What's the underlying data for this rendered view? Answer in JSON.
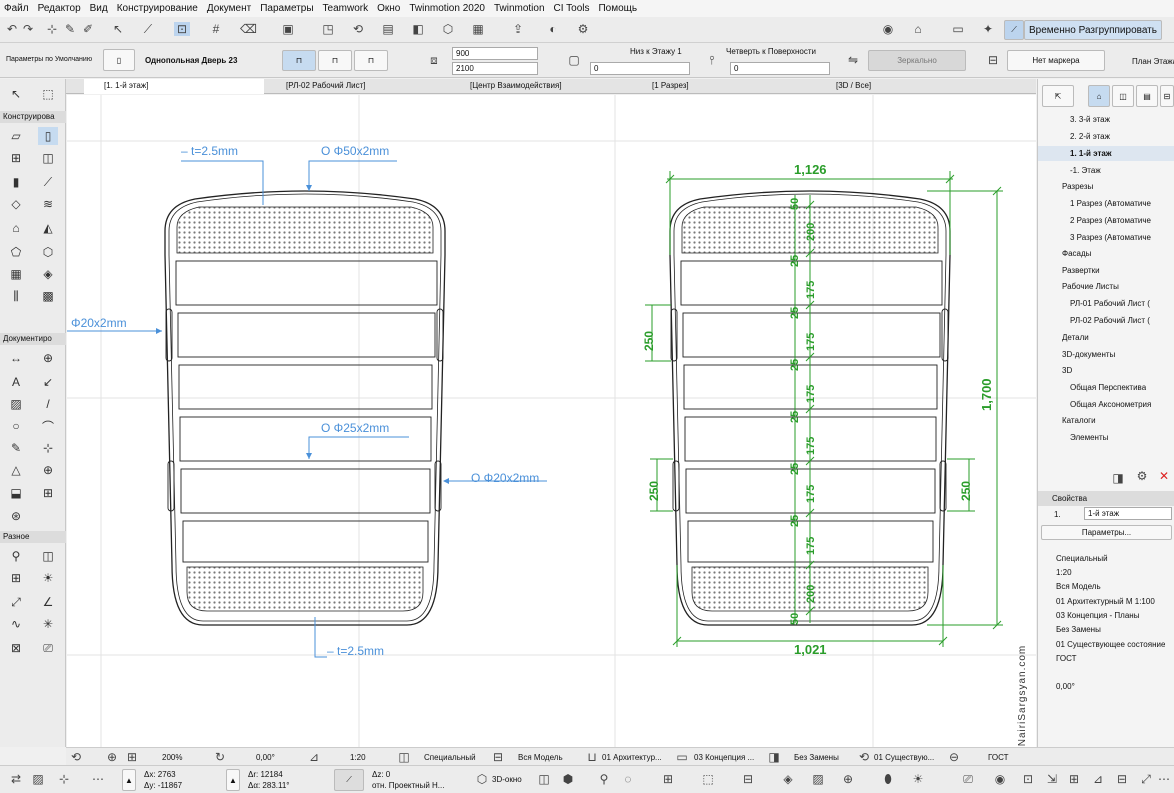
{
  "menu": [
    "Файл",
    "Редактор",
    "Вид",
    "Конструирование",
    "Документ",
    "Параметры",
    "Teamwork",
    "Окно",
    "Twinmotion 2020",
    "Twinmotion",
    "CI Tools",
    "Помощь"
  ],
  "ungroup_label": "Временно Разгруппировать",
  "infobox": {
    "defaults": "Параметры по Умолчанию",
    "door_name": "Однопольная Дверь 23",
    "width": "900",
    "height": "2100",
    "bottom_label": "Низ к Этажу 1",
    "bottom_value": "0",
    "quarter_label": "Четверть к Поверхности",
    "quarter_value": "0",
    "mirror_label": "Зеркально",
    "marker": "Нет маркера",
    "plan_label": "План Этажа"
  },
  "tabs": [
    "[1. 1-й этаж]",
    "[РЛ-02 Рабочий Лист]",
    "[Центр Взаимодействия]",
    "[1 Разрез]",
    "[3D / Все]"
  ],
  "toolbox": {
    "design": "Конструирова",
    "document": "Документиро",
    "misc": "Разное"
  },
  "tree": [
    "3. 3-й этаж",
    "2. 2-й этаж",
    "1. 1-й этаж",
    "-1. Этаж",
    "Разрезы",
    "1 Разрез (Автоматиче",
    "2 Разрез (Автоматиче",
    "3 Разрез (Автоматиче",
    "Фасады",
    "Развертки",
    "Рабочие Листы",
    "РЛ-01 Рабочий Лист (",
    "РЛ-02 Рабочий Лист (",
    "Детали",
    "3D-документы",
    "3D",
    "Общая Перспектива",
    "Общая Аксонометрия",
    "Каталоги",
    "Элементы"
  ],
  "props": {
    "header": "Свойства",
    "id": "1.",
    "name": "1-й этаж",
    "button": "Параметры...",
    "items": [
      "Специальный",
      "1:20",
      "Вся Модель",
      "01 Архитектурный М 1:100",
      "03 Концепция - Планы",
      "Без Замены",
      "01 Существующее состояние",
      "ГОСТ",
      "",
      "0,00°"
    ]
  },
  "drawing": {
    "t_top": "– t=2.5mm",
    "t_bot": "– t=2.5mm",
    "d50": "O Φ50x2mm",
    "d20l": "Φ20x2mm",
    "d25": "O Φ25x2mm",
    "d20r": "O Φ20x2mm",
    "w_top": "1,126",
    "w_bot": "1,021",
    "h": "1,700",
    "side_l1": "250",
    "side_l2": "250",
    "side_r": "250",
    "dims_a": [
      "50",
      "25",
      "25",
      "25",
      "25",
      "25",
      "25",
      "50"
    ],
    "dims_b": [
      "200",
      "175",
      "175",
      "175",
      "175",
      "175",
      "175",
      "200"
    ]
  },
  "status": {
    "zoom": "200%",
    "angle": "0,00°",
    "scale": "1:20",
    "layer": "Специальный",
    "model": "Вся Модель",
    "arch": "01 Архитектур...",
    "concept": "03 Концепция ...",
    "replace": "Без Замены",
    "exist": "01 Существую...",
    "gost": "ГОСТ"
  },
  "coords": {
    "dx": "Δx: 2763",
    "dy": "Δy: -11867",
    "dr": "Δr: 12184",
    "da": "Δα: 283.11°",
    "dz": "Δz: 0",
    "rel": "отн. Проектный Н...",
    "view3d": "3D-окно"
  },
  "watermark": "© NairiSargsyan.com",
  "colors": {
    "dim": "#2a9d2a",
    "blue_text": "#4a90d9"
  }
}
